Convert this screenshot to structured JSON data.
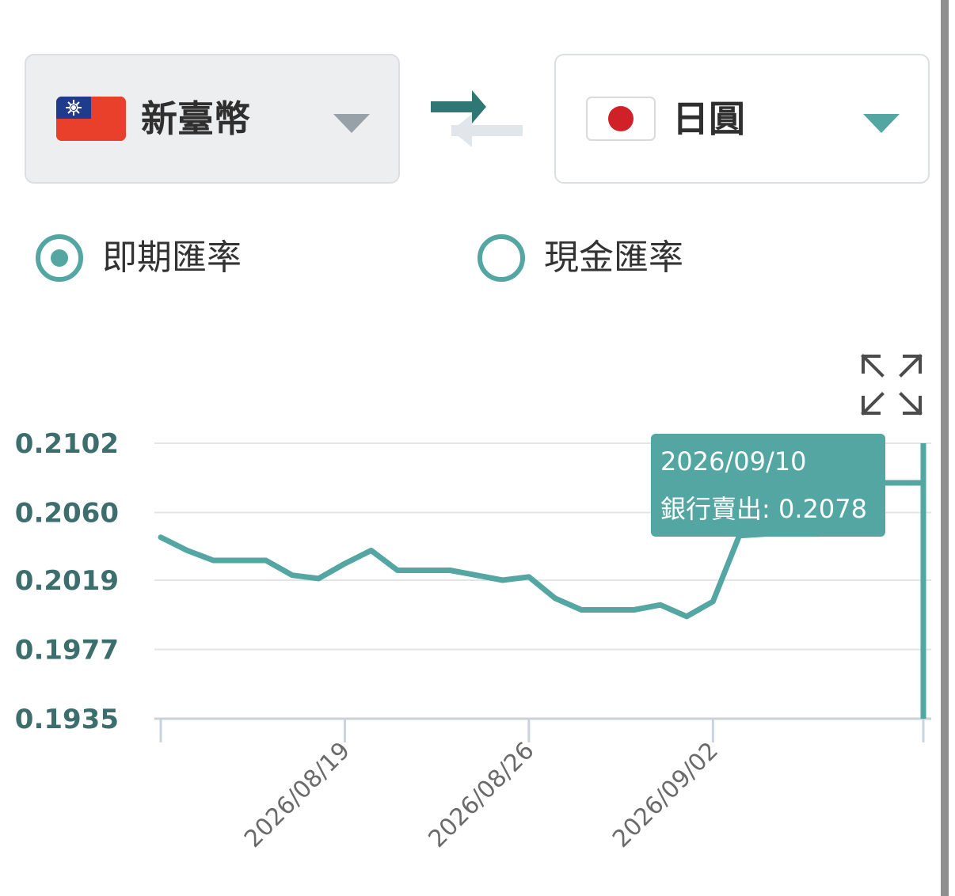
{
  "from_currency": {
    "name": "新臺幣",
    "flag": "taiwan-flag-icon"
  },
  "to_currency": {
    "name": "日圓",
    "flag": "japan-flag-icon"
  },
  "rate_type": {
    "options": [
      {
        "label": "即期匯率",
        "selected": true
      },
      {
        "label": "現金匯率",
        "selected": false
      }
    ]
  },
  "colors": {
    "accent": "#53a6a2",
    "swap_active": "#2f7775",
    "swap_inactive": "#e1e6ea",
    "axis_label": "#3b6e6c"
  },
  "tooltip": {
    "date": "2026/09/10",
    "label": "銀行賣出: 0.2078"
  },
  "chart_data": {
    "type": "line",
    "ylim": [
      0.1935,
      0.2102
    ],
    "yticks": [
      "0.2102",
      "0.2060",
      "0.2019",
      "0.1977",
      "0.1935"
    ],
    "xticks": [
      "2026/08/19",
      "2026/08/26",
      "2026/09/02"
    ],
    "x": [
      "2026/08/12",
      "2026/08/13",
      "2026/08/14",
      "2026/08/15",
      "2026/08/16",
      "2026/08/17",
      "2026/08/18",
      "2026/08/19",
      "2026/08/20",
      "2026/08/21",
      "2026/08/22",
      "2026/08/23",
      "2026/08/24",
      "2026/08/25",
      "2026/08/26",
      "2026/08/27",
      "2026/08/28",
      "2026/08/29",
      "2026/08/30",
      "2026/08/31",
      "2026/09/01",
      "2026/09/02",
      "2026/09/03",
      "2026/09/04",
      "2026/09/05",
      "2026/09/06",
      "2026/09/07",
      "2026/09/08",
      "2026/09/09",
      "2026/09/10"
    ],
    "series": [
      {
        "values": [
          0.2045,
          0.2037,
          0.2031,
          0.2031,
          0.2031,
          0.2022,
          0.202,
          0.2029,
          0.2037,
          0.2025,
          0.2025,
          0.2025,
          0.2022,
          0.2019,
          0.2021,
          0.2008,
          0.2001,
          0.2001,
          0.2001,
          0.2004,
          0.1997,
          0.2006,
          0.2046,
          0.2047,
          0.2047,
          0.2047,
          0.2056,
          0.2078,
          0.2078,
          0.2078
        ]
      }
    ],
    "highlight_date": "2026/09/10"
  }
}
